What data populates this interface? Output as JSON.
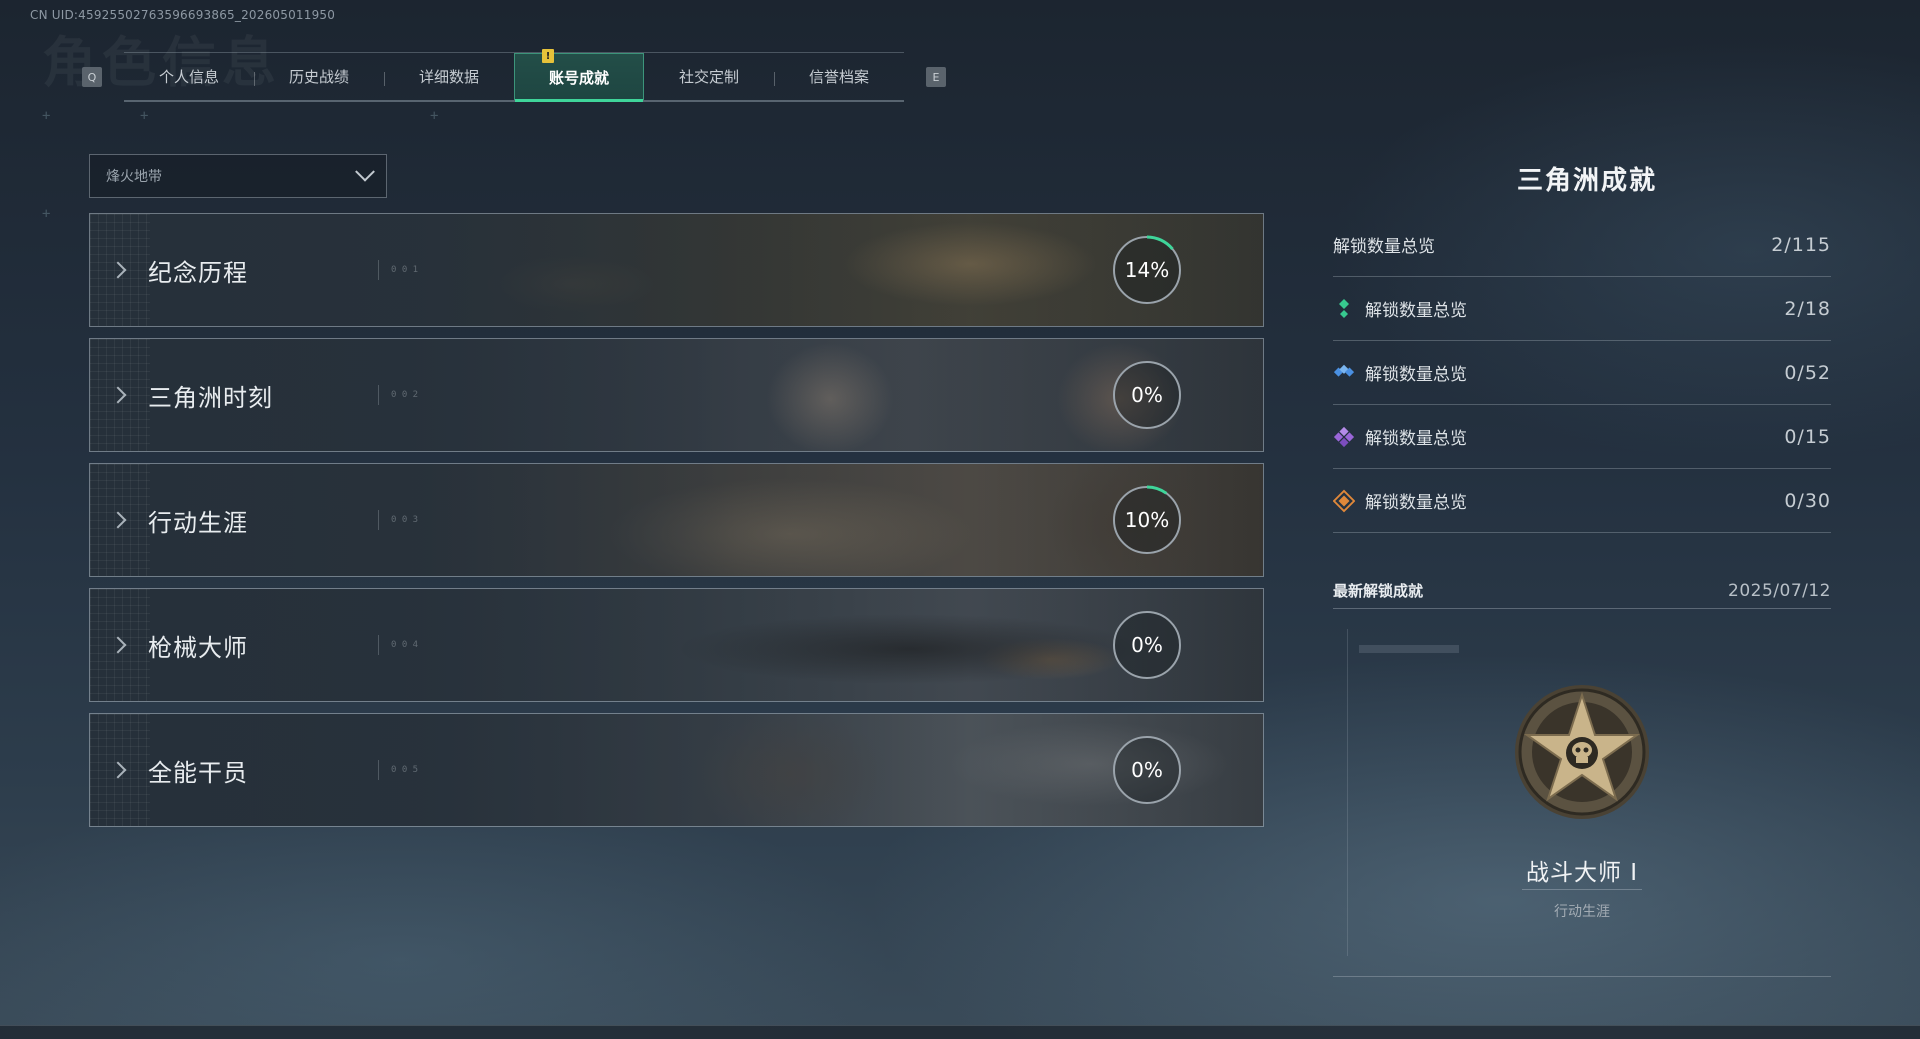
{
  "header": {
    "uid": "CN UID:4592550276359669386​5_202605011950",
    "bg_title": "角色信息"
  },
  "tabs": {
    "left_key": "Q",
    "right_key": "E",
    "items": [
      {
        "label": "个人信息",
        "active": false
      },
      {
        "label": "历史战绩",
        "active": false
      },
      {
        "label": "详细数据",
        "active": false
      },
      {
        "label": "账号成就",
        "active": true
      },
      {
        "label": "社交定制",
        "active": false
      },
      {
        "label": "信誉档案",
        "active": false
      }
    ],
    "notice": "!"
  },
  "mode_select": {
    "value": "烽火地带"
  },
  "achievements": [
    {
      "name": "纪念历程",
      "code": "0 0 1",
      "progress": 14,
      "progress_label": "14%"
    },
    {
      "name": "三角洲时刻",
      "code": "0 0 2",
      "progress": 0,
      "progress_label": "0%"
    },
    {
      "name": "行动生涯",
      "code": "0 0 3",
      "progress": 10,
      "progress_label": "10%"
    },
    {
      "name": "枪械大师",
      "code": "0 0 4",
      "progress": 0,
      "progress_label": "0%"
    },
    {
      "name": "全能干员",
      "code": "0 0 5",
      "progress": 0,
      "progress_label": "0%"
    }
  ],
  "panel": {
    "title": "三角洲成就",
    "total": {
      "label": "解锁数量总览",
      "value": "2/115"
    },
    "tiers": [
      {
        "label": "解锁数量总览",
        "value": "2/18",
        "icon": "green-gem-icon",
        "color": "#37c98f"
      },
      {
        "label": "解锁数量总览",
        "value": "0/52",
        "icon": "blue-gem-icon",
        "color": "#4a90e2"
      },
      {
        "label": "解锁数量总览",
        "value": "0/15",
        "icon": "purple-gem-icon",
        "color": "#9a66d8"
      },
      {
        "label": "解锁数量总览",
        "value": "0/30",
        "icon": "orange-gem-icon",
        "color": "#e0883a"
      }
    ],
    "latest": {
      "heading": "最新解锁成就",
      "date": "2025/07/12",
      "name": "战斗大师 I",
      "category": "行动生涯"
    }
  },
  "colors": {
    "accent": "#3fd59a",
    "ring_track": "#9aa3ab"
  }
}
